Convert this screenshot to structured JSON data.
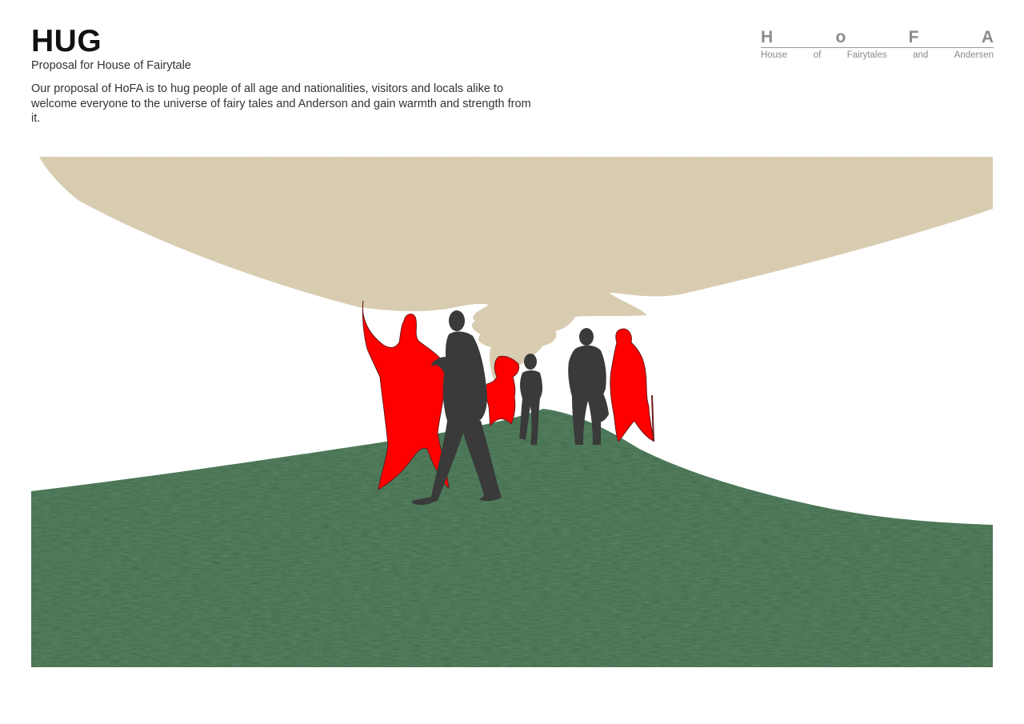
{
  "header": {
    "title": "HUG",
    "subtitle": "Proposal for House of Fairytale",
    "description": "Our proposal of HoFA is to hug people of all age and nationalities, visitors and locals alike to welcome everyone to the universe of fairy tales and Anderson and gain warmth and strength from it."
  },
  "logo": {
    "letters": [
      "H",
      "o",
      "F",
      "A"
    ],
    "words": [
      "House",
      "of",
      "Fairytales",
      "and",
      "Andersen"
    ]
  },
  "illustration": {
    "canopy_color": "#ddd0b4",
    "grass_color": "#3f6b48",
    "figure_color": "#ff0000",
    "people_color": "#3a3a3a"
  }
}
